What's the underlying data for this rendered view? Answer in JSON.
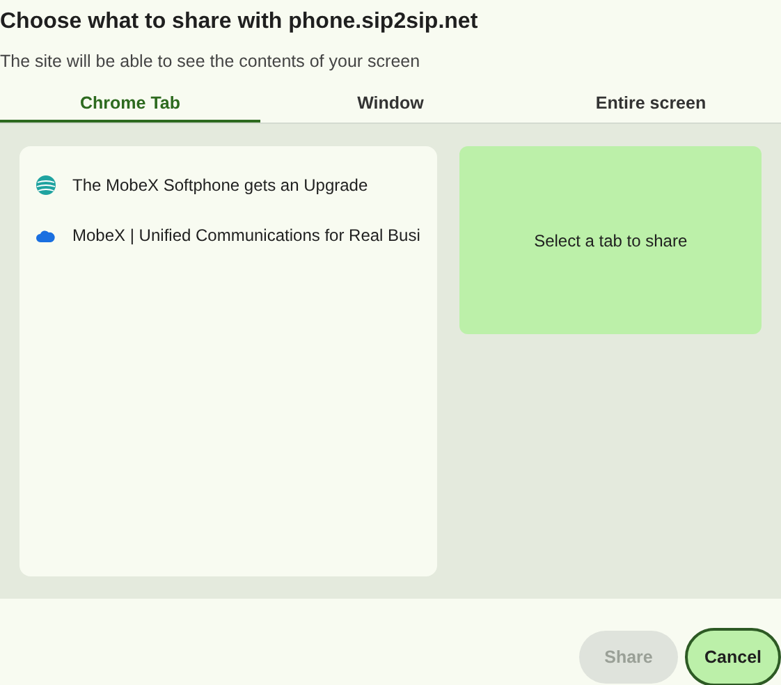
{
  "title": "Choose what to share with phone.sip2sip.net",
  "subtitle": "The site will be able to see the contents of your screen",
  "tabs": [
    {
      "label": "Chrome Tab",
      "selected": true
    },
    {
      "label": "Window",
      "selected": false
    },
    {
      "label": "Entire screen",
      "selected": false
    }
  ],
  "tab_list": [
    {
      "title": "The MobeX Softphone gets an Upgrade",
      "kind": "globe"
    },
    {
      "title": "MobeX | Unified Communications for Real Busi",
      "kind": "cloud"
    }
  ],
  "preview": {
    "text": "Select a tab to share"
  },
  "buttons": [
    {
      "label": "Share",
      "disabled": true
    },
    {
      "label": "Cancel",
      "disabled": false
    }
  ]
}
